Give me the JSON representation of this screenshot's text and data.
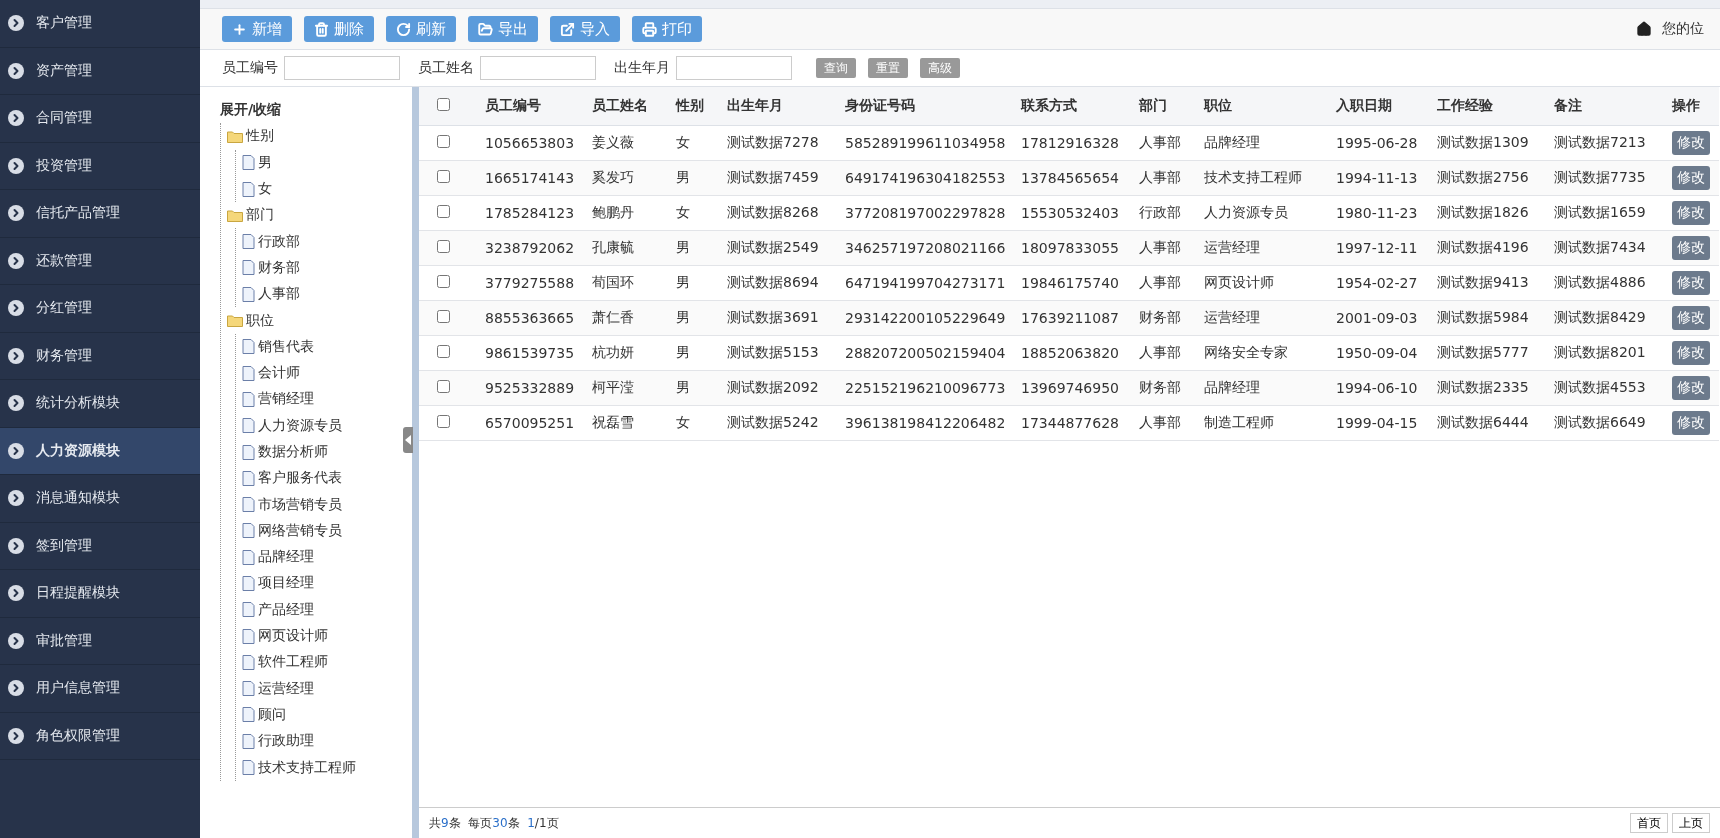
{
  "sidebar": {
    "items": [
      {
        "label": "客户管理",
        "selected": false
      },
      {
        "label": "资产管理",
        "selected": false
      },
      {
        "label": "合同管理",
        "selected": false
      },
      {
        "label": "投资管理",
        "selected": false
      },
      {
        "label": "信托产品管理",
        "selected": false
      },
      {
        "label": "还款管理",
        "selected": false
      },
      {
        "label": "分红管理",
        "selected": false
      },
      {
        "label": "财务管理",
        "selected": false
      },
      {
        "label": "统计分析模块",
        "selected": false
      },
      {
        "label": "人力资源模块",
        "selected": true
      },
      {
        "label": "消息通知模块",
        "selected": false
      },
      {
        "label": "签到管理",
        "selected": false
      },
      {
        "label": "日程提醒模块",
        "selected": false
      },
      {
        "label": "审批管理",
        "selected": false
      },
      {
        "label": "用户信息管理",
        "selected": false
      },
      {
        "label": "角色权限管理",
        "selected": false
      }
    ]
  },
  "toolbar": {
    "buttons": [
      {
        "kind": "add",
        "label": "新增"
      },
      {
        "kind": "delete",
        "label": "删除"
      },
      {
        "kind": "refresh",
        "label": "刷新"
      },
      {
        "kind": "export",
        "label": "导出"
      },
      {
        "kind": "import",
        "label": "导入"
      },
      {
        "kind": "print",
        "label": "打印"
      }
    ],
    "breadcrumb": "您的位"
  },
  "search": {
    "fields": [
      {
        "label": "员工编号"
      },
      {
        "label": "员工姓名"
      },
      {
        "label": "出生年月"
      }
    ],
    "buttons": [
      "查询",
      "重置",
      "高级"
    ]
  },
  "tree": {
    "label": "展开/收缩",
    "expanded": true,
    "children": [
      {
        "label": "性别",
        "expanded": true,
        "children": [
          {
            "label": "男"
          },
          {
            "label": "女"
          }
        ]
      },
      {
        "label": "部门",
        "expanded": true,
        "children": [
          {
            "label": "行政部"
          },
          {
            "label": "财务部"
          },
          {
            "label": "人事部"
          }
        ]
      },
      {
        "label": "职位",
        "expanded": true,
        "children": [
          {
            "label": "销售代表"
          },
          {
            "label": "会计师"
          },
          {
            "label": "营销经理"
          },
          {
            "label": "人力资源专员"
          },
          {
            "label": "数据分析师"
          },
          {
            "label": "客户服务代表"
          },
          {
            "label": "市场营销专员"
          },
          {
            "label": "网络营销专员"
          },
          {
            "label": "品牌经理"
          },
          {
            "label": "项目经理"
          },
          {
            "label": "产品经理"
          },
          {
            "label": "网页设计师"
          },
          {
            "label": "软件工程师"
          },
          {
            "label": "运营经理"
          },
          {
            "label": "顾问"
          },
          {
            "label": "行政助理"
          },
          {
            "label": "技术支持工程师"
          }
        ]
      }
    ]
  },
  "table": {
    "select_all": {
      "checked": false
    },
    "columns": [
      "员工编号",
      "员工姓名",
      "性别",
      "出生年月",
      "身份证号码",
      "联系方式",
      "部门",
      "职位",
      "入职日期",
      "工作经验",
      "备注",
      "操作"
    ],
    "rows": [
      {
        "checked": false,
        "cells": [
          "1056653803",
          "姜义薇",
          "女",
          "测试数据7278",
          "585289199611034958",
          "17812916328",
          "人事部",
          "品牌经理",
          "1995-06-28",
          "测试数据1309",
          "测试数据7213"
        ],
        "action": "修改"
      },
      {
        "checked": false,
        "cells": [
          "1665174143",
          "奚发巧",
          "男",
          "测试数据7459",
          "649174196304182553",
          "13784565654",
          "人事部",
          "技术支持工程师",
          "1994-11-13",
          "测试数据2756",
          "测试数据7735"
        ],
        "action": "修改"
      },
      {
        "checked": false,
        "cells": [
          "1785284123",
          "鲍鹏丹",
          "女",
          "测试数据8268",
          "377208197002297828",
          "15530532403",
          "行政部",
          "人力资源专员",
          "1980-11-23",
          "测试数据1826",
          "测试数据1659"
        ],
        "action": "修改"
      },
      {
        "checked": false,
        "cells": [
          "3238792062",
          "孔康毓",
          "男",
          "测试数据2549",
          "346257197208021166",
          "18097833055",
          "人事部",
          "运营经理",
          "1997-12-11",
          "测试数据4196",
          "测试数据7434"
        ],
        "action": "修改"
      },
      {
        "checked": false,
        "cells": [
          "3779275588",
          "荀国环",
          "男",
          "测试数据8694",
          "647194199704273171",
          "19846175740",
          "人事部",
          "网页设计师",
          "1954-02-27",
          "测试数据9413",
          "测试数据4886"
        ],
        "action": "修改"
      },
      {
        "checked": false,
        "cells": [
          "8855363665",
          "萧仁香",
          "男",
          "测试数据3691",
          "293142200105229649",
          "17639211087",
          "财务部",
          "运营经理",
          "2001-09-03",
          "测试数据5984",
          "测试数据8429"
        ],
        "action": "修改"
      },
      {
        "checked": false,
        "cells": [
          "9861539735",
          "杭功妍",
          "男",
          "测试数据5153",
          "288207200502159404",
          "18852063820",
          "人事部",
          "网络安全专家",
          "1950-09-04",
          "测试数据5777",
          "测试数据8201"
        ],
        "action": "修改"
      },
      {
        "checked": false,
        "cells": [
          "9525332889",
          "柯平滢",
          "男",
          "测试数据2092",
          "225152196210096773",
          "13969746950",
          "财务部",
          "品牌经理",
          "1994-06-10",
          "测试数据2335",
          "测试数据4553"
        ],
        "action": "修改"
      },
      {
        "checked": false,
        "cells": [
          "6570095251",
          "祝磊雪",
          "女",
          "测试数据5242",
          "396138198412206482",
          "17344877628",
          "人事部",
          "制造工程师",
          "1999-04-15",
          "测试数据6444",
          "测试数据6649"
        ],
        "action": "修改"
      }
    ]
  },
  "pager": {
    "parts": [
      {
        "text": "共",
        "highlight": false
      },
      {
        "text": "9",
        "highlight": true
      },
      {
        "text": "条  每页",
        "highlight": false
      },
      {
        "text": "30",
        "highlight": true
      },
      {
        "text": "条  ",
        "highlight": false
      },
      {
        "text": "1",
        "highlight": true
      },
      {
        "text": "/1页",
        "highlight": false
      }
    ],
    "buttons": [
      "首页",
      "上页"
    ]
  }
}
